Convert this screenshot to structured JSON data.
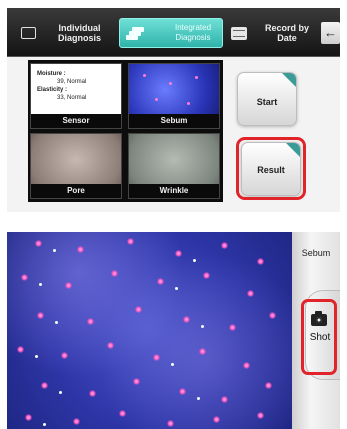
{
  "top_screen": {
    "tabs": [
      {
        "label": "Individual Diagnosis",
        "icon": "square-icon",
        "active": false
      },
      {
        "label": "Integrated Diagnosis",
        "icon": "stack-icon",
        "active": true
      },
      {
        "label": "Record by Date",
        "icon": "records-icon",
        "active": false
      }
    ],
    "back_label": "←",
    "tiles": {
      "sensor": {
        "label": "Sensor",
        "moisture_label": "Moisture :",
        "moisture_value": "39, Normal",
        "elasticity_label": "Elasticity :",
        "elasticity_value": "33, Normal"
      },
      "sebum": {
        "label": "Sebum"
      },
      "pore": {
        "label": "Pore"
      },
      "wrinkle": {
        "label": "Wrinkle"
      }
    },
    "start_label": "Start",
    "result_label": "Result"
  },
  "bottom_screen": {
    "mode_label": "Sebum",
    "shot_label": "Shot"
  },
  "colors": {
    "highlight": "#e0242a",
    "accent": "#2fb3aa",
    "sebum_view": "#2e36a8"
  }
}
